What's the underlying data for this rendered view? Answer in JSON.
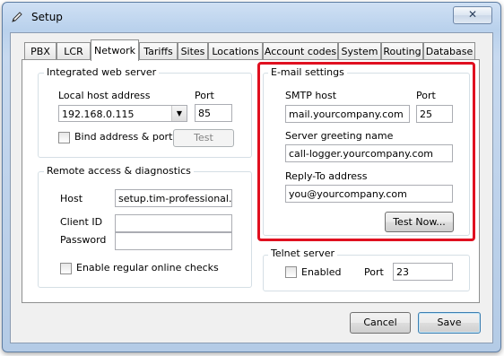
{
  "window": {
    "title": "Setup",
    "close_label": "✕"
  },
  "tabs": [
    {
      "label": "PBX"
    },
    {
      "label": "LCR"
    },
    {
      "label": "Network"
    },
    {
      "label": "Tariffs"
    },
    {
      "label": "Sites"
    },
    {
      "label": "Locations"
    },
    {
      "label": "Account codes"
    },
    {
      "label": "System"
    },
    {
      "label": "Routing"
    },
    {
      "label": "Database"
    }
  ],
  "active_tab": "Network",
  "web_server": {
    "title": "Integrated web server",
    "host_label": "Local host address",
    "host_value": "192.168.0.115",
    "port_label": "Port",
    "port_value": "85",
    "bind_label": "Bind address & port",
    "bind_checked": false,
    "test_label": "Test"
  },
  "remote": {
    "title": "Remote access & diagnostics",
    "host_label": "Host",
    "host_value": "setup.tim-professional.com",
    "client_id_label": "Client ID",
    "client_id_value": "",
    "password_label": "Password",
    "password_value": "",
    "checks_label": "Enable regular online checks",
    "checks_checked": false
  },
  "email": {
    "title": "E-mail settings",
    "smtp_label": "SMTP host",
    "smtp_value": "mail.yourcompany.com",
    "port_label": "Port",
    "port_value": "25",
    "greeting_label": "Server greeting name",
    "greeting_value": "call-logger.yourcompany.com",
    "reply_label": "Reply-To address",
    "reply_value": "you@yourcompany.com",
    "test_label": "Test Now..."
  },
  "telnet": {
    "title": "Telnet server",
    "enabled_label": "Enabled",
    "enabled_checked": false,
    "port_label": "Port",
    "port_value": "23"
  },
  "footer": {
    "cancel_label": "Cancel",
    "save_label": "Save"
  },
  "colors": {
    "highlight": "#e01020",
    "title_bar": "#b9d1ec"
  }
}
